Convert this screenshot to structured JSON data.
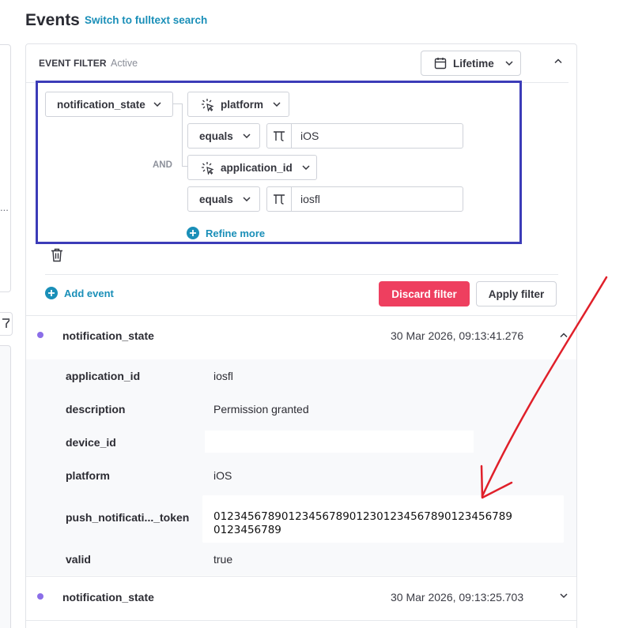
{
  "header": {
    "title": "Events",
    "switch_link": "Switch to fulltext search"
  },
  "left_panel": {
    "ellipsis": "..."
  },
  "filter": {
    "title": "EVENT FILTER",
    "status": "Active",
    "time_range": "Lifetime",
    "event_name": "notification_state",
    "logic_operator": "AND",
    "conditions": [
      {
        "property": "platform",
        "operator": "equals",
        "value": "iOS"
      },
      {
        "property": "application_id",
        "operator": "equals",
        "value": "iosfl"
      }
    ],
    "refine_more": "Refine more",
    "add_event": "Add event",
    "discard_label": "Discard filter",
    "apply_label": "Apply filter"
  },
  "events": [
    {
      "name": "notification_state",
      "timestamp": "30 Mar 2026, 09:13:41.276",
      "expanded": true,
      "properties": {
        "application_id": {
          "key": "application_id",
          "value": "iosfl"
        },
        "description": {
          "key": "description",
          "value": "Permission granted"
        },
        "device_id": {
          "key": "device_id",
          "value": ""
        },
        "platform": {
          "key": "platform",
          "value": "iOS"
        },
        "push_token": {
          "key": "push_notificati..._token",
          "value_line1": "01234567890123456789012301234567890123456789",
          "value_line2": "0123456789"
        },
        "valid": {
          "key": "valid",
          "value": "true"
        }
      }
    },
    {
      "name": "notification_state",
      "timestamp": "30 Mar 2026, 09:13:25.703",
      "expanded": false
    }
  ],
  "colors": {
    "accent_link": "#1a8fb8",
    "discard_button": "#ee3f5f",
    "event_dot": "#8b6ee8",
    "annotation_box": "#3c3cb8",
    "annotation_arrow": "#e0202a"
  },
  "icons": {
    "calendar": "calendar-icon",
    "chevron": "chevron-down-icon",
    "property": "property-cursor-icon",
    "text_type": "text-type-icon",
    "plus": "plus-circle-icon",
    "trash": "trash-icon",
    "funnel": "funnel-icon"
  }
}
